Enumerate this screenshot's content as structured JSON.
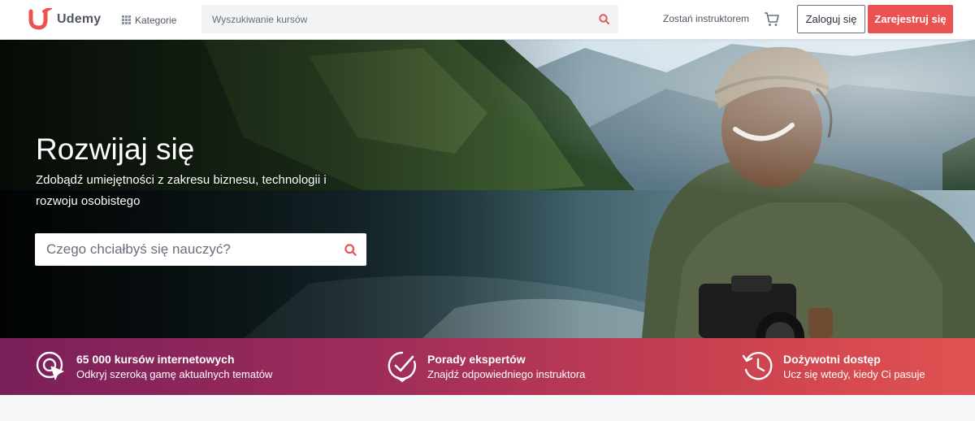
{
  "header": {
    "logo_text": "Udemy",
    "categories_label": "Kategorie",
    "search_placeholder": "Wyszukiwanie kursów",
    "become_instructor": "Zostań instruktorem",
    "login": "Zaloguj się",
    "signup": "Zarejestruj się"
  },
  "hero": {
    "title": "Rozwijaj się",
    "subtitle": "Zdobądź umiejętności z zakresu biznesu, technologii i rozwoju osobistego",
    "search_placeholder": "Czego chciałbyś się nauczyć?"
  },
  "features": [
    {
      "title": "65 000 kursów internetowych",
      "subtitle": "Odkryj szeroką gamę aktualnych tematów",
      "icon": "cursor-target-icon"
    },
    {
      "title": "Porady ekspertów",
      "subtitle": "Znajdź odpowiedniego instruktora",
      "icon": "badge-check-icon"
    },
    {
      "title": "Dożywotni dostęp",
      "subtitle": "Ucz się wtedy, kiedy Ci pasuje",
      "icon": "history-clock-icon"
    }
  ],
  "colors": {
    "brand": "#ec5252",
    "text": "#505763",
    "strip_start": "#7a1f5a",
    "strip_end": "#e05252"
  }
}
